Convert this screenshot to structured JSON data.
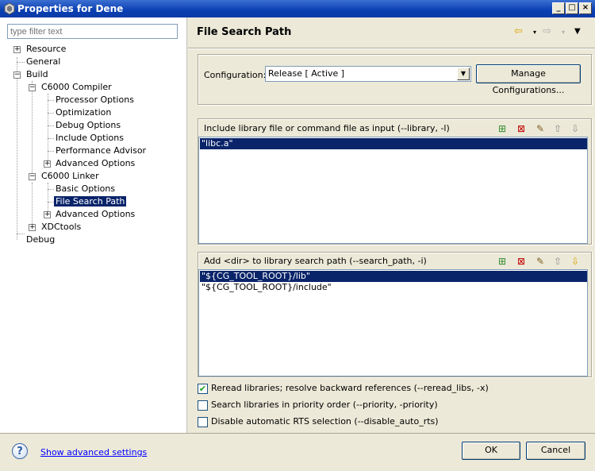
{
  "window": {
    "title": "Properties for Dene"
  },
  "filter": {
    "placeholder": "type filter text"
  },
  "tree": {
    "items": [
      {
        "label": "Resource"
      },
      {
        "label": "General"
      },
      {
        "label": "Build"
      },
      {
        "label": "C6000 Compiler"
      },
      {
        "label": "Processor Options"
      },
      {
        "label": "Optimization"
      },
      {
        "label": "Debug Options"
      },
      {
        "label": "Include Options"
      },
      {
        "label": "Performance Advisor"
      },
      {
        "label": "Advanced Options"
      },
      {
        "label": "C6000 Linker"
      },
      {
        "label": "Basic Options"
      },
      {
        "label": "File Search Path"
      },
      {
        "label": "Advanced Options"
      },
      {
        "label": "XDCtools"
      },
      {
        "label": "Debug"
      }
    ]
  },
  "page": {
    "title": "File Search Path"
  },
  "configuration": {
    "label": "Configuration:",
    "value": "Release  [ Active ]",
    "manage_button": "Manage Configurations..."
  },
  "library_list": {
    "header": "Include library file or command file as input (--library, -l)",
    "items": [
      "\"libc.a\""
    ]
  },
  "search_path_list": {
    "header": "Add <dir> to library search path (--search_path, -i)",
    "items": [
      "\"${CG_TOOL_ROOT}/lib\"",
      "\"${CG_TOOL_ROOT}/include\""
    ]
  },
  "options": {
    "reread": {
      "label": "Reread libraries; resolve backward references (--reread_libs, -x)",
      "checked": true
    },
    "priority": {
      "label": "Search libraries in priority order (--priority, -priority)",
      "checked": false
    },
    "disable_rts": {
      "label": "Disable automatic RTS selection (--disable_auto_rts)",
      "checked": false
    }
  },
  "footer": {
    "advanced_link": "Show advanced settings",
    "ok_button": "OK",
    "cancel_button": "Cancel"
  }
}
